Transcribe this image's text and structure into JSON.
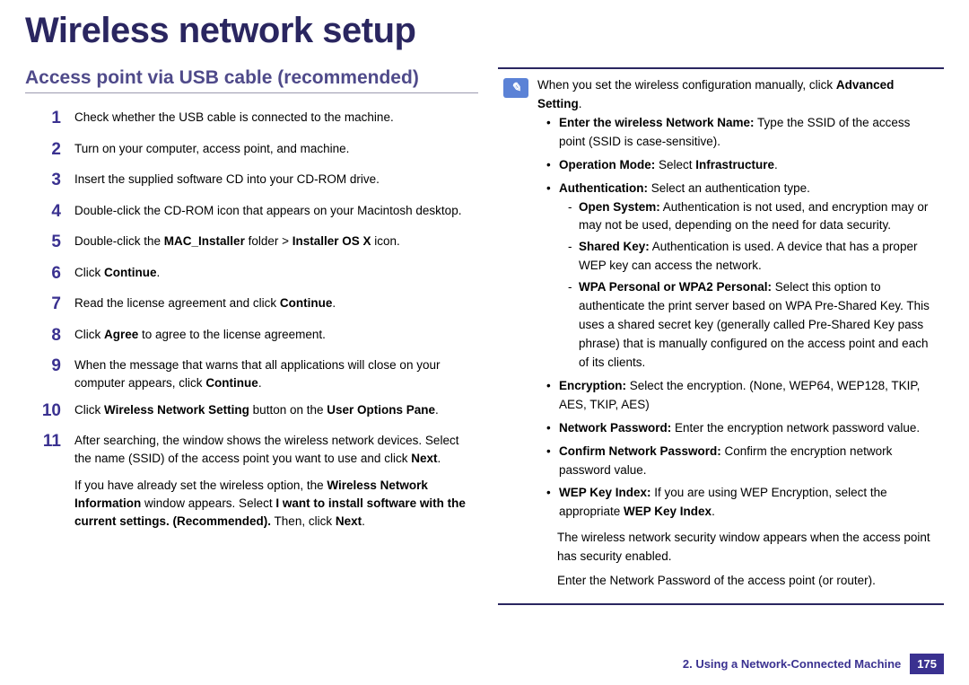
{
  "pageTitle": "Wireless network setup",
  "sectionHeading": "Access point via USB cable (recommended)",
  "steps": [
    {
      "num": "1",
      "html": "Check whether the USB cable is connected to the machine."
    },
    {
      "num": "2",
      "html": "Turn on your computer, access point, and machine."
    },
    {
      "num": "3",
      "html": "Insert the supplied software CD into your CD-ROM drive."
    },
    {
      "num": "4",
      "html": "Double-click the CD-ROM icon that appears on your Macintosh desktop."
    },
    {
      "num": "5",
      "html": "Double-click the <b>MAC_Installer</b> folder > <b>Installer OS X</b> icon."
    },
    {
      "num": "6",
      "html": "Click <b>Continue</b>."
    },
    {
      "num": "7",
      "html": "Read the license agreement and click <b>Continue</b>."
    },
    {
      "num": "8",
      "html": "Click <b>Agree</b> to agree to the license agreement."
    },
    {
      "num": "9",
      "html": "When the message that warns that all applications will close on your computer appears, click <b>Continue</b>."
    },
    {
      "num": "10",
      "html": "Click <b>Wireless Network Setting</b> button on the <b>User Options Pane</b>."
    },
    {
      "num": "11",
      "html": "After searching, the window shows the wireless network devices. Select the name (SSID) of the access point you want to use and click <b>Next</b>."
    }
  ],
  "step11Tail": "If you have already set the wireless option, the <b>Wireless Network Information</b> window appears. Select <b>I want to install software with the current settings. (Recommended).</b> Then, click <b>Next</b>.",
  "note": "When you set the wireless configuration manually, click <b>Advanced Setting</b>.",
  "bullets": [
    {
      "html": "<b>Enter the wireless Network Name:</b> Type the SSID of the access point (SSID is case-sensitive)."
    },
    {
      "html": "<b>Operation Mode:</b> Select <b>Infrastructure</b>."
    },
    {
      "html": "<b>Authentication:</b> Select an authentication type.",
      "dashes": [
        "<b>Open System:</b> Authentication is not used, and encryption may or may not be used, depending on the need for data security.",
        "<b>Shared Key:</b> Authentication is used. A device that has a proper WEP key can access the network.",
        "<b>WPA Personal or WPA2 Personal:</b> Select this option to authenticate the print server based on WPA Pre-Shared Key. This uses a shared secret key (generally called Pre-Shared Key pass phrase) that is manually configured on the access point and each of its clients."
      ]
    },
    {
      "html": "<b>Encryption:</b> Select the encryption. (None, WEP64, WEP128, TKIP, AES, TKIP, AES)"
    },
    {
      "html": "<b>Network Password:</b> Enter the encryption network password value."
    },
    {
      "html": "<b>Confirm Network Password:</b> Confirm the encryption network password value."
    },
    {
      "html": "<b>WEP Key Index:</b> If you are using WEP Encryption, select the appropriate <b>WEP Key Index</b>."
    }
  ],
  "tailParagraphs": [
    "The wireless network security window appears when the access point has security enabled.",
    "Enter the Network Password of the access point (or router)."
  ],
  "footerText": "2.  Using a Network-Connected Machine",
  "pageNumber": "175"
}
